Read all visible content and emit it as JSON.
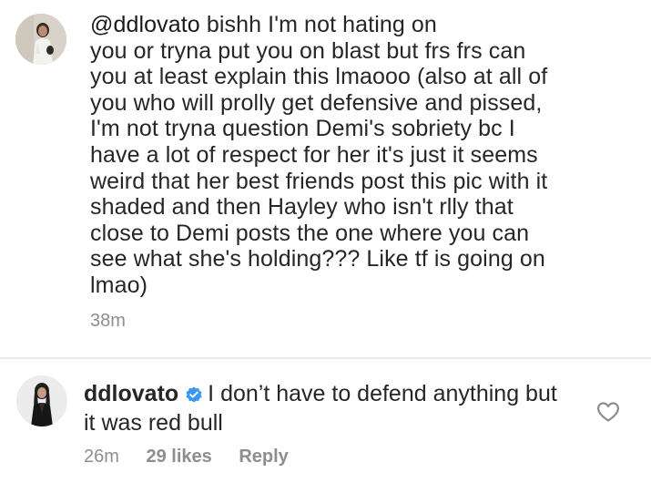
{
  "comment_1": {
    "mention": "@ddlovato",
    "text_after_mention": " bishh I'm not hating on",
    "body_lines": [
      "you or tryna put you on blast but frs frs can",
      "you at least explain this lmaooo (also at all of",
      "you who will prolly get defensive and pissed,",
      "I'm not tryna question Demi's sobriety bc I",
      "have a lot of respect for her it's just it seems",
      "weird that her best friends post this pic with it",
      "shaded and then Hayley who isn't rlly that",
      "close to Demi posts the one where you can",
      "see what she's holding??? Like tf is going on",
      "lmao)"
    ],
    "time": "38m"
  },
  "comment_2": {
    "username": "ddlovato",
    "verified_icon": "verified-badge-icon",
    "text_line1": "I don’t have to defend anything but",
    "text_line2": "it was red bull",
    "time": "26m",
    "likes": "29 likes",
    "reply_label": "Reply",
    "like_icon": "heart-outline-icon"
  },
  "colors": {
    "text": "#262626",
    "muted": "#8e8e8e",
    "verified": "#3897f0",
    "divider": "#ebebeb"
  }
}
